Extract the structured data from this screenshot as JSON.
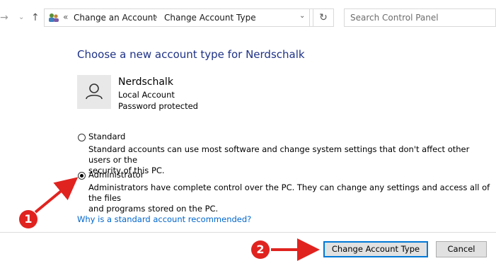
{
  "address_bar": {
    "chevrons": "«",
    "crumb1": "Change an Account",
    "sep": "›",
    "crumb2": "Change Account Type"
  },
  "search": {
    "placeholder": "Search Control Panel"
  },
  "page": {
    "title": "Choose a new account type for Nerdschalk"
  },
  "account": {
    "name": "Nerdschalk",
    "type": "Local Account",
    "security": "Password protected"
  },
  "options": {
    "standard": {
      "label": "Standard",
      "desc_line1": "Standard accounts can use most software and change system settings that don't affect other users or the",
      "desc_line2": "security of this PC.",
      "selected": false
    },
    "administrator": {
      "label": "Administrator",
      "desc_line1": "Administrators have complete control over the PC. They can change any settings and access all of the files",
      "desc_line2": "and programs stored on the PC.",
      "selected": true
    }
  },
  "help_link": "Why is a standard account recommended?",
  "buttons": {
    "change": "Change Account Type",
    "cancel": "Cancel"
  },
  "annotations": {
    "badge1": "1",
    "badge2": "2",
    "color": "#e0231f"
  }
}
